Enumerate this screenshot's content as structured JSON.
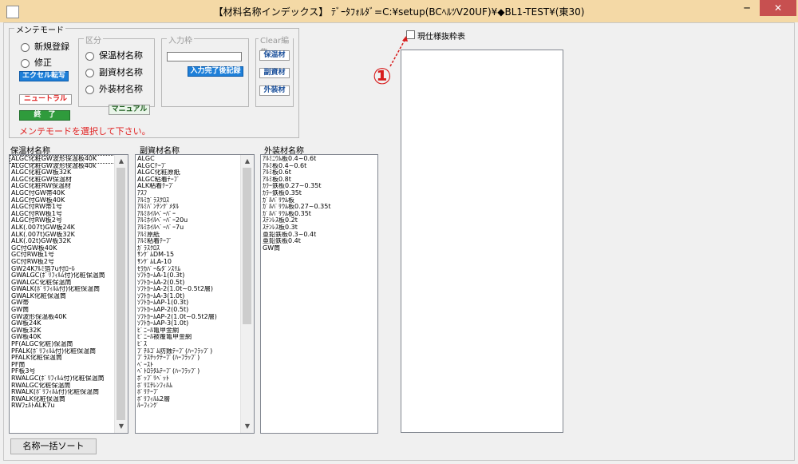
{
  "window": {
    "title": "【材料名称インデックス】 ﾃﾞｰﾀﾌｫﾙﾀﾞ=C:¥setup(BCﾍﾙﾂV20UF)¥◆BL1-TEST¥(東30)",
    "minimize_label": "─",
    "close_label": "✕"
  },
  "maintenance": {
    "legend": "メンテモード",
    "new_label": "新規登録",
    "edit_label": "修正",
    "excel_button": "エクセル転写",
    "neutral_button": "ニュートラル",
    "end_button": "終　了",
    "manual_button": "マニュアル",
    "message": "メンテモードを選択して下さい。"
  },
  "category": {
    "legend": "区分",
    "insulation_label": "保温材名称",
    "auxiliary_label": "副資材名称",
    "exterior_label": "外装材名称"
  },
  "input": {
    "legend": "入力枠",
    "value": "",
    "complete_button": "入力完了後記録"
  },
  "clear_edit": {
    "legend": "Clear編集",
    "insulation_button": "保温材",
    "auxiliary_button": "副資材",
    "exterior_button": "外装材"
  },
  "current_spec": {
    "checkbox_label": "現仕様抜粋表",
    "checked": false
  },
  "annotation": {
    "number": "①",
    "color": "#d71c1c"
  },
  "lists": {
    "insulation": {
      "label": "保温材名称",
      "items": [
        "ALGC化粧GW波形保温板40K",
        "ALGC化粧GW波形保温板40k",
        "ALGC化粧GW板32K",
        "ALGC化粧GW保温材",
        "ALGC化粧RW保温材",
        "ALGC付GW帯40K",
        "ALGC付GW板40K",
        "ALGC付RW帯1号",
        "ALGC付RW板1号",
        "ALGC付RW板2号",
        "ALK(.007t)GW板24K",
        "ALK(.007t)GW板32K",
        "ALK(.02t)GW板32K",
        "GC付GW板40K",
        "GC付RW板1号",
        "GC付RW板2号",
        "GW24Kｱﾙﾐ箔7u付ﾛｰﾙ",
        "GWALGC(ﾎﾟﾘﾌｨﾙﾑ付)化粧保温筒",
        "GWALGC化粧保温筒",
        "GWALK(ﾎﾟﾘﾌｨﾙﾑ付)化粧保温筒",
        "GWALK化粧保温筒",
        "GW帯",
        "GW筒",
        "GW波形保温板40K",
        "GW板24K",
        "GW板32K",
        "GW板40K",
        "PF(ALGC化粧)保温筒",
        "PFALK(ﾎﾟﾘﾌｨﾙﾑ付)化粧保温筒",
        "PFALK化粧保温筒",
        "PF筒",
        "PF板3号",
        "RWALGC(ﾎﾟﾘﾌｨﾙﾑ付)化粧保温筒",
        "RWALGC化粧保温筒",
        "RWALK(ﾎﾟﾘﾌｨﾙﾑ付)化粧保温筒",
        "RWALK化粧保温筒",
        "RWﾌｪﾙﾄALK7u"
      ]
    },
    "auxiliary": {
      "label": "副資材名称",
      "items": [
        "ALGC",
        "ALGCﾃｰﾌﾟ",
        "ALGC化粧原紙",
        "ALGC粘着ﾃｰﾌﾟ",
        "ALK粘着ﾃｰﾌﾟ",
        "ｱｽﾌ",
        "ｱﾙﾐｶﾞﾗｽｸﾛｽ",
        "ｱﾙﾐﾊﾟﾝﾁﾝｸﾞﾒﾀﾙ",
        "ｱﾙﾐﾎｲﾙﾍﾟｰﾊﾟｰ",
        "ｱﾙﾐﾎｲﾙﾍﾟｰﾊﾟｰ20u",
        "ｱﾙﾐﾎｲﾙﾍﾟｰﾊﾟｰ7u",
        "ｱﾙﾐ原紙",
        "ｱﾙﾐ粘着ﾃｰﾌﾟ",
        "ｶﾞﾗｽｸﾛｽ",
        "ｻﾝｹﾞﾑDM-15",
        "ｻﾝｹﾞﾑLA-10",
        "ｾﾗｶﾊﾞｰ&ﾀﾞﾝｽﾘﾑ",
        "ｿﾌﾄｶｰﾑA-1(0.3t)",
        "ｿﾌﾄｶｰﾑA-2(0.5t)",
        "ｿﾌﾄｶｰﾑA-2(1.0t~0.5t2層)",
        "ｿﾌﾄｶｰﾑA-3(1.0t)",
        "ｿﾌﾄｶｰﾑAP-1(0.3t)",
        "ｿﾌﾄｶｰﾑAP-2(0.5t)",
        "ｿﾌﾄｶｰﾑAP-2(1.0t~0.5t2層)",
        "ｿﾌﾄｶｰﾑAP-3(1.0t)",
        "ﾋﾞﾆｰﾙ亀甲金網",
        "ﾋﾞﾆｰﾙ被覆亀甲金網",
        "ﾋﾞｽ",
        "ﾌﾞﾁﾙｺﾞﾑ防蝕ﾃｰﾌﾟ(ﾊｰﾌﾗｯﾌﾟ)",
        "ﾌﾟﾗｽﾁｯｸﾃｰﾌﾟ(ﾊｰﾌﾗｯﾌﾟ)",
        "ﾍﾟｰｽﾄ",
        "ﾍﾟﾄﾛﾗﾀﾑﾃｰﾌﾟ(ﾊｰﾌﾗｯﾌﾟ)",
        "ﾎﾟｯﾌﾟﾘﾍﾞｯﾄ",
        "ﾎﾟﾘｴﾁﾚﾝﾌｨﾙﾑ",
        "ﾎﾟﾘﾃｰﾌﾟ",
        "ﾎﾟﾘﾌｨﾙﾑ2層",
        "ﾙｰﾌｨﾝｸﾞ"
      ]
    },
    "exterior": {
      "label": "外装材名称",
      "items": [
        "ｱﾙﾐﾆｳﾑ板0.4~0.6t",
        "ｱﾙﾐ板0.4~0.6t",
        "ｱﾙﾐ板0.6t",
        "ｱﾙﾐ板0.8t",
        "ｶﾗｰ鉄板0.27~0.35t",
        "ｶﾗｰ鉄板0.35t",
        "ｶﾞﾙﾊﾞﾘｳﾑ板",
        "ｶﾞﾙﾊﾞﾘｳﾑ板0.27~0.35t",
        "ｶﾞﾙﾊﾞﾘｳﾑ板0.35t",
        "ｽﾃﾝﾚｽ板0.2t",
        "ｽﾃﾝﾚｽ板0.3t",
        "亜鉛鉄板0.3~0.4t",
        "亜鉛鉄板0.4t",
        "GW筒"
      ]
    }
  },
  "sort_button": "名称一括ソート",
  "colors": {
    "titlebar": "#f4d9a6",
    "accent_blue": "#1e7fd8",
    "end_green": "#2f9b3c",
    "warning_red": "#e02020"
  }
}
